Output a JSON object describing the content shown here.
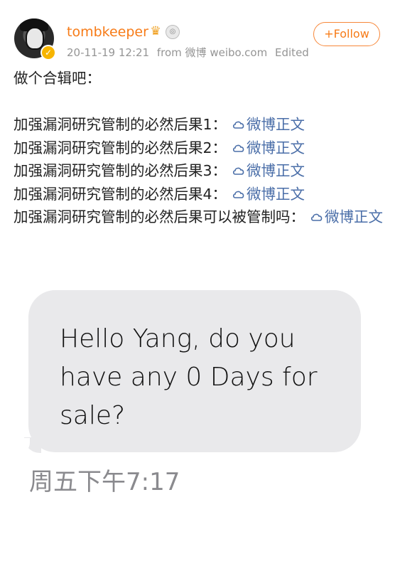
{
  "header": {
    "username": "tombkeeper",
    "timestamp": "20-11-19 12:21",
    "source": "from 微博 weibo.com",
    "edited_label": "Edited",
    "follow_label": "+Follow",
    "verified_icon": "verified-badge-icon",
    "badges": [
      "crown-icon",
      "medal-icon"
    ]
  },
  "post": {
    "intro": "做个合辑吧：",
    "items": [
      {
        "text": "加强漏洞研究管制的必然后果1：",
        "link": "微博正文"
      },
      {
        "text": "加强漏洞研究管制的必然后果2：",
        "link": "微博正文"
      },
      {
        "text": "加强漏洞研究管制的必然后果3：",
        "link": "微博正文"
      },
      {
        "text": "加强漏洞研究管制的必然后果4：",
        "link": "微博正文"
      },
      {
        "text": "加强漏洞研究管制的必然后果可以被管制吗：",
        "link": "微博正文"
      }
    ]
  },
  "image": {
    "message": "Hello Yang, do you have any 0 Days for sale?",
    "time": "周五下午7:17"
  },
  "colors": {
    "accent": "#f77b17",
    "link": "#4a6ea8",
    "bubble": "#e9e9eb"
  }
}
